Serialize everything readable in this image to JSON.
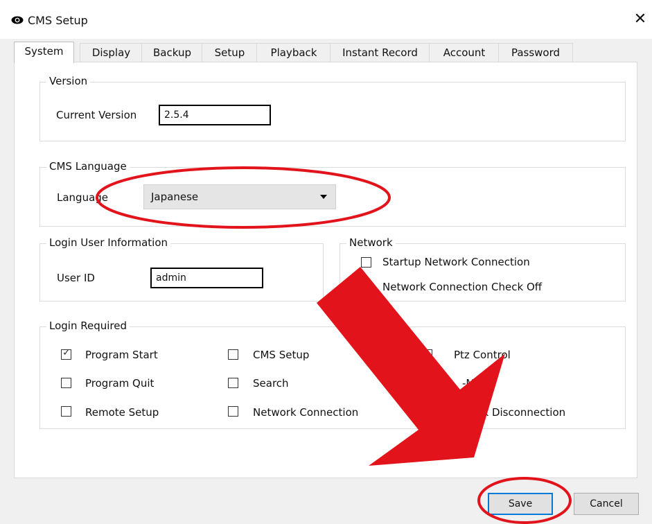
{
  "window": {
    "title": "CMS Setup",
    "close_glyph": "✕",
    "icon": "eye-icon"
  },
  "tabs": [
    {
      "label": "System",
      "active": true
    },
    {
      "label": "Display"
    },
    {
      "label": "Backup"
    },
    {
      "label": "Setup"
    },
    {
      "label": "Playback"
    },
    {
      "label": "Instant Record"
    },
    {
      "label": "Account"
    },
    {
      "label": "Password"
    }
  ],
  "version": {
    "group_label": "Version",
    "current_label": "Current Version",
    "current_value": "2.5.4"
  },
  "language": {
    "group_label": "CMS Language",
    "label": "Language",
    "selected": "Japanese"
  },
  "login_user": {
    "group_label": "Login User Information",
    "user_id_label": "User ID",
    "user_id_value": "admin"
  },
  "network": {
    "group_label": "Network",
    "items": [
      {
        "label": "Startup Network Connection",
        "checked": false
      },
      {
        "label": "Network Connection Check Off",
        "checked": false
      }
    ]
  },
  "login_required": {
    "group_label": "Login Required",
    "items": [
      {
        "label": "Program Start",
        "checked": true
      },
      {
        "label": "CMS Setup",
        "checked": false
      },
      {
        "label": "Ptz Control",
        "checked": false
      },
      {
        "label": "Program Quit",
        "checked": false
      },
      {
        "label": "Search",
        "checked": false
      },
      {
        "label": "-Map",
        "checked": false
      },
      {
        "label": "Remote Setup",
        "checked": false
      },
      {
        "label": "Network Connection",
        "checked": false
      },
      {
        "label": "twork Disconnection",
        "checked": false
      }
    ]
  },
  "buttons": {
    "save": "Save",
    "cancel": "Cancel"
  },
  "annotation_colors": {
    "highlight": "#e3131b",
    "accent": "#0078d7"
  }
}
